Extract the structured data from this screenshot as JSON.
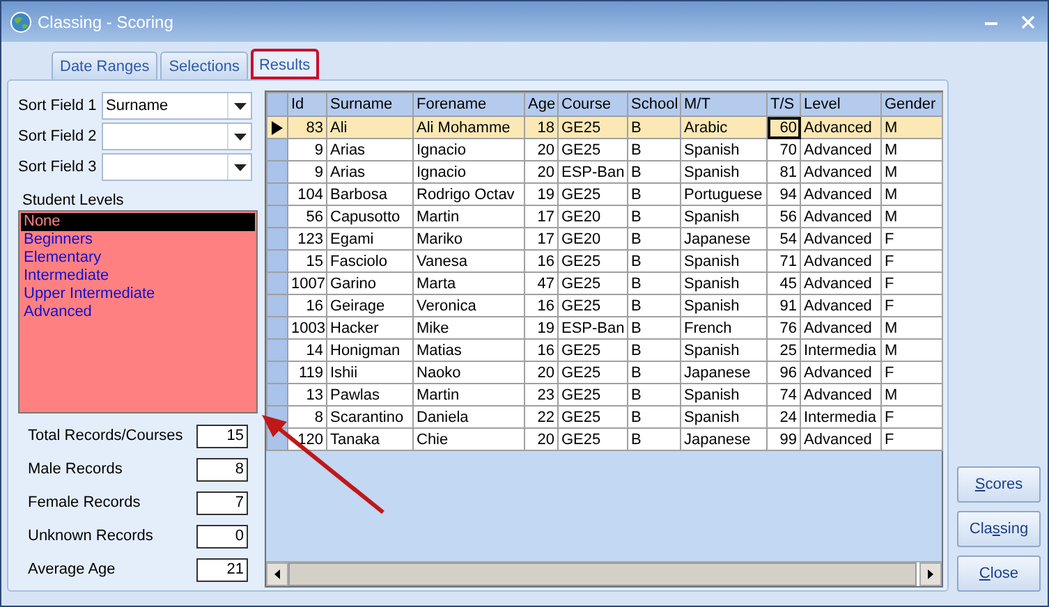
{
  "window": {
    "title": "Classing - Scoring"
  },
  "tabs": [
    {
      "label": "Date Ranges",
      "selected": false
    },
    {
      "label": "Selections",
      "selected": false
    },
    {
      "label": "Results",
      "selected": true
    }
  ],
  "sort_fields": [
    {
      "label": "Sort Field 1",
      "value": "Surname"
    },
    {
      "label": "Sort Field 2"
    },
    {
      "label": "Sort Field 3"
    }
  ],
  "student_levels": {
    "label": "Student Levels",
    "items": [
      {
        "label": "None",
        "selected": true
      },
      {
        "label": "Beginners",
        "selected": false
      },
      {
        "label": "Elementary",
        "selected": false
      },
      {
        "label": "Intermediate",
        "selected": false
      },
      {
        "label": "Upper Intermediate",
        "selected": false
      },
      {
        "label": "Advanced",
        "selected": false
      }
    ]
  },
  "stats": [
    {
      "label": "Total Records/Courses",
      "value": "15"
    },
    {
      "label": "Male Records",
      "value": "8"
    },
    {
      "label": "Female Records",
      "value": "7"
    },
    {
      "label": "Unknown Records",
      "value": "0"
    },
    {
      "label": "Average Age",
      "value": "21"
    }
  ],
  "table": {
    "columns": [
      {
        "label": "Id",
        "kind": "number",
        "focused": false
      },
      {
        "label": "Surname",
        "kind": "text",
        "focused": false
      },
      {
        "label": "Forename",
        "kind": "text",
        "focused": false
      },
      {
        "label": "Age",
        "kind": "number",
        "focused": false
      },
      {
        "label": "Course",
        "kind": "text",
        "focused": false
      },
      {
        "label": "School",
        "kind": "text",
        "focused": false
      },
      {
        "label": "M/T",
        "kind": "text",
        "focused": false
      },
      {
        "label": "T/S",
        "kind": "number",
        "focused": true
      },
      {
        "label": "Level",
        "kind": "text",
        "focused": false
      },
      {
        "label": "Gender",
        "kind": "text",
        "focused": false
      }
    ],
    "rows": [
      {
        "selected": true,
        "cells": [
          "83",
          "Ali",
          "Ali Mohamme",
          "18",
          "GE25",
          "B",
          "Arabic",
          "60",
          "Advanced",
          "M"
        ]
      },
      {
        "selected": false,
        "cells": [
          "9",
          "Arias",
          "Ignacio",
          "20",
          "GE25",
          "B",
          "Spanish",
          "70",
          "Advanced",
          "M"
        ]
      },
      {
        "selected": false,
        "cells": [
          "9",
          "Arias",
          "Ignacio",
          "20",
          "ESP-Ban",
          "B",
          "Spanish",
          "81",
          "Advanced",
          "M"
        ]
      },
      {
        "selected": false,
        "cells": [
          "104",
          "Barbosa",
          "Rodrigo Octav",
          "19",
          "GE25",
          "B",
          "Portuguese",
          "94",
          "Advanced",
          "M"
        ]
      },
      {
        "selected": false,
        "cells": [
          "56",
          "Capusotto",
          "Martin",
          "17",
          "GE20",
          "B",
          "Spanish",
          "56",
          "Advanced",
          "M"
        ]
      },
      {
        "selected": false,
        "cells": [
          "123",
          "Egami",
          "Mariko",
          "17",
          "GE20",
          "B",
          "Japanese",
          "54",
          "Advanced",
          "F"
        ]
      },
      {
        "selected": false,
        "cells": [
          "15",
          "Fasciolo",
          "Vanesa",
          "16",
          "GE25",
          "B",
          "Spanish",
          "71",
          "Advanced",
          "F"
        ]
      },
      {
        "selected": false,
        "cells": [
          "1007",
          "Garino",
          "Marta",
          "47",
          "GE25",
          "B",
          "Spanish",
          "45",
          "Advanced",
          "F"
        ]
      },
      {
        "selected": false,
        "cells": [
          "16",
          "Geirage",
          "Veronica",
          "16",
          "GE25",
          "B",
          "Spanish",
          "91",
          "Advanced",
          "F"
        ]
      },
      {
        "selected": false,
        "cells": [
          "1003",
          "Hacker",
          "Mike",
          "19",
          "ESP-Ban",
          "B",
          "French",
          "76",
          "Advanced",
          "M"
        ]
      },
      {
        "selected": false,
        "cells": [
          "14",
          "Honigman",
          "Matias",
          "16",
          "GE25",
          "B",
          "Spanish",
          "25",
          "Intermedia",
          "M"
        ]
      },
      {
        "selected": false,
        "cells": [
          "119",
          "Ishii",
          "Naoko",
          "20",
          "GE25",
          "B",
          "Japanese",
          "96",
          "Advanced",
          "F"
        ]
      },
      {
        "selected": false,
        "cells": [
          "13",
          "Pawlas",
          "Martin",
          "23",
          "GE25",
          "B",
          "Spanish",
          "74",
          "Advanced",
          "M"
        ]
      },
      {
        "selected": false,
        "cells": [
          "8",
          "Scarantino",
          "Daniela",
          "22",
          "GE25",
          "B",
          "Spanish",
          "24",
          "Intermedia",
          "F"
        ]
      },
      {
        "selected": false,
        "cells": [
          "120",
          "Tanaka",
          "Chie",
          "20",
          "GE25",
          "B",
          "Japanese",
          "99",
          "Advanced",
          "F"
        ]
      }
    ]
  },
  "buttons": [
    {
      "key": "S",
      "after": "cores"
    },
    {
      "before": "Cla",
      "key": "s",
      "after": "sing"
    },
    {
      "key": "C",
      "after": "lose"
    }
  ]
}
